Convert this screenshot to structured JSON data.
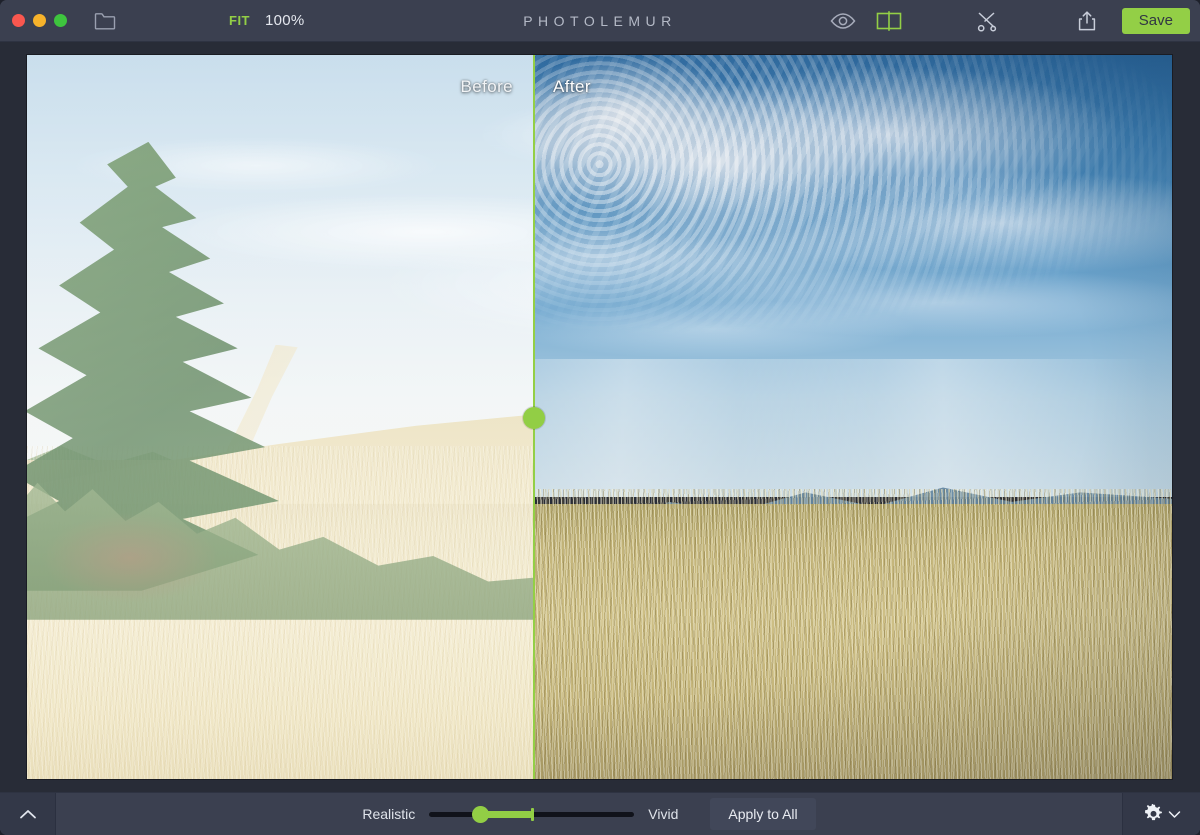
{
  "app": {
    "title": "PHOTOLEMUR"
  },
  "titlebar": {
    "window_controls": [
      {
        "name": "close",
        "color": "#f9574f"
      },
      {
        "name": "minimize",
        "color": "#f7b32b"
      },
      {
        "name": "maximize",
        "color": "#3ec53e"
      }
    ],
    "open_folder_icon": "folder-icon",
    "fit_label": "FIT",
    "zoom_level": "100%",
    "preview_icon": "eye-icon",
    "compare_icon": "split-view-icon",
    "crop_icon": "scissors-icon",
    "share_icon": "share-icon",
    "save_label": "Save",
    "accent_green": "#93cf46",
    "bar_background": "#3b4050"
  },
  "canvas": {
    "before_label": "Before",
    "after_label": "After",
    "divider_color": "#93cf46",
    "divider_x_percent": 44,
    "handle_name": "compare-slider-handle"
  },
  "bottombar": {
    "panel_toggle_icon": "chevron-up-icon",
    "slider_min_label": "Realistic",
    "slider_max_label": "Vivid",
    "slider_value_percent": 25,
    "slider_default_marker_percent": 50,
    "apply_to_all_label": "Apply to All",
    "settings_icon": "gear-icon",
    "settings_chevron_icon": "chevron-down-icon"
  }
}
